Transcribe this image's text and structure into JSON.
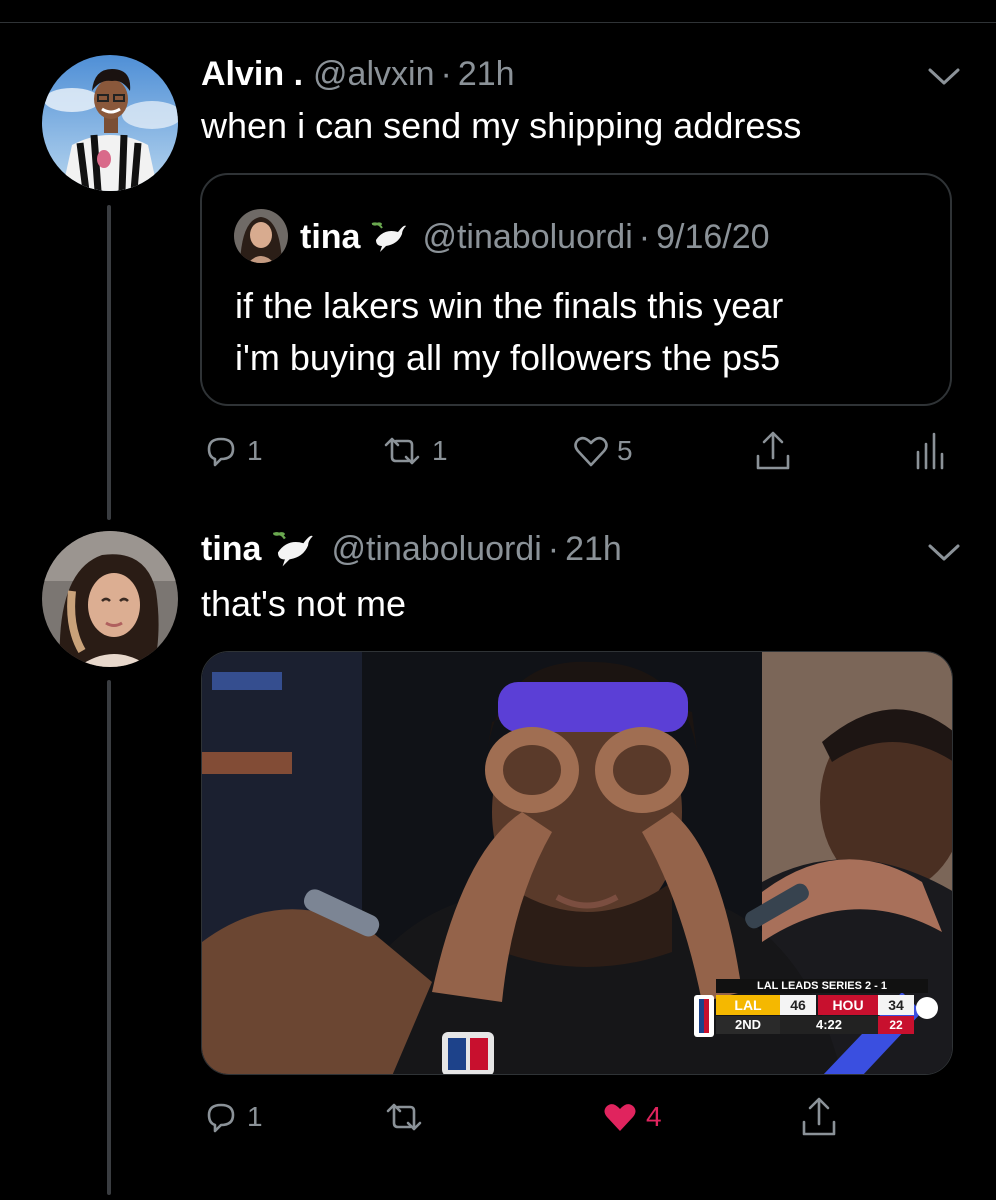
{
  "tweet1": {
    "display_name": "Alvin .",
    "handle": "@alvxin",
    "separator": "·",
    "time": "21h",
    "text": "when i can send my shipping address",
    "quote": {
      "display_name": "tina",
      "emoji_icon": "dove-with-olive-branch-icon",
      "handle": "@tinaboluordi",
      "separator": "·",
      "date": "9/16/20",
      "line1": "if the lakers win the finals this year",
      "line2": "i'm buying all my followers the ps5"
    },
    "actions": {
      "reply_count": "1",
      "retweet_count": "1",
      "like_count": "5"
    }
  },
  "tweet2": {
    "display_name": "tina",
    "emoji_icon": "dove-with-olive-branch-icon",
    "handle": "@tinaboluordi",
    "separator": "·",
    "time": "21h",
    "text": "that's not me",
    "media": {
      "scorebug": {
        "banner": "LAL LEADS SERIES 2 - 1",
        "team1": "LAL",
        "score1": "46",
        "team2": "HOU",
        "score2": "34",
        "quarter": "2ND",
        "clock": "4:22",
        "shot_clock": "22"
      }
    },
    "actions": {
      "reply_count": "1",
      "like_count": "4",
      "liked": true
    }
  },
  "colors": {
    "background": "#000000",
    "muted": "#8b9298",
    "border": "#2f3336",
    "like_active": "#e0245e"
  }
}
